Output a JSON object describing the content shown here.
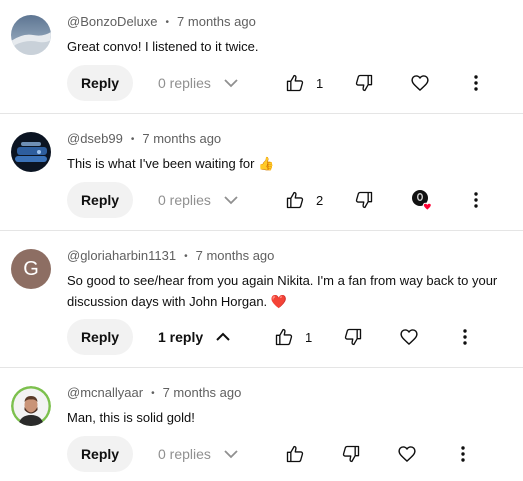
{
  "comments": [
    {
      "author": "@BonzoDeluxe",
      "time": "7 months ago",
      "text": "Great convo! I listened to it twice.",
      "reply_label": "Reply",
      "replies_text": "0 replies",
      "likes": "1"
    },
    {
      "author": "@dseb99",
      "time": "7 months ago",
      "text": "This is what I've been waiting for 👍",
      "reply_label": "Reply",
      "replies_text": "0 replies",
      "likes": "2",
      "creator_heart": true
    },
    {
      "author": "@gloriaharbin1131",
      "avatar_letter": "G",
      "time": "7 months ago",
      "text": "So good to see/hear from you again Nikita.  I'm a fan from way back to your discussion days with John Horgan. ❤️",
      "reply_label": "Reply",
      "replies_text": "1 reply",
      "likes": "1"
    },
    {
      "author": "@mcnallyaar",
      "time": "7 months ago",
      "text": "Man, this is solid gold!",
      "reply_label": "Reply",
      "replies_text": "0 replies",
      "likes": ""
    }
  ],
  "separator": "•",
  "colors": {
    "meta": "#606060",
    "reply_button_bg": "#f2f2f2",
    "heart_red": "#ff0033",
    "avatar_g": "#8d6e63"
  }
}
